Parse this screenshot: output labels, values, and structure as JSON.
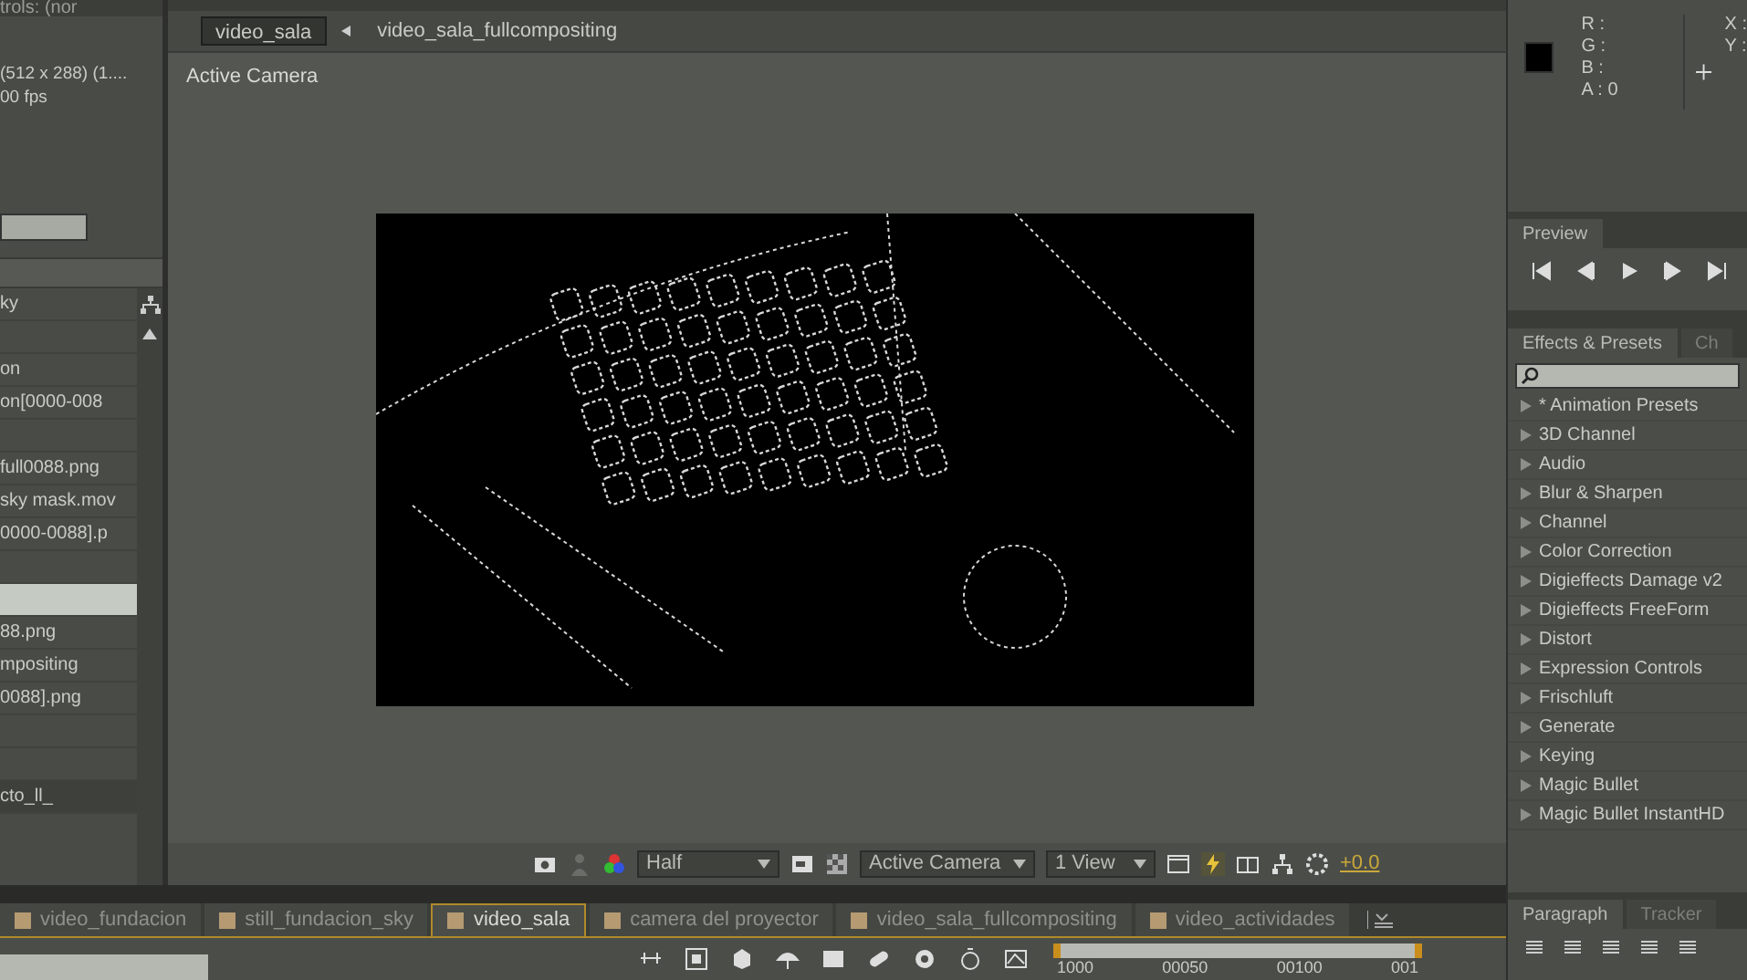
{
  "project_panel": {
    "header": "trols: (nor",
    "info_lines": [
      "(512 x 288) (1....",
      "00 fps"
    ],
    "items": [
      {
        "kind": "text",
        "label": "ky",
        "selected": false
      },
      {
        "kind": "blank",
        "selected": false
      },
      {
        "kind": "text",
        "label": "on",
        "selected": false
      },
      {
        "kind": "text",
        "label": "on[0000-008",
        "selected": false
      },
      {
        "kind": "blank",
        "selected": false
      },
      {
        "kind": "text",
        "label": "full0088.png",
        "selected": false
      },
      {
        "kind": "text",
        "label": "sky mask.mov",
        "selected": false
      },
      {
        "kind": "text",
        "label": "0000-0088].p",
        "selected": false
      },
      {
        "kind": "blank",
        "selected": false
      },
      {
        "kind": "blank",
        "selected": true
      },
      {
        "kind": "text",
        "label": "88.png",
        "selected": false
      },
      {
        "kind": "text",
        "label": "mpositing",
        "selected": false
      },
      {
        "kind": "text",
        "label": "0088].png",
        "selected": false
      },
      {
        "kind": "blank",
        "selected": false
      },
      {
        "kind": "blank",
        "selected": false
      },
      {
        "kind": "text",
        "label": "cto_ll_",
        "selected": false
      }
    ]
  },
  "composition": {
    "breadcrumbs": [
      {
        "label": "video_sala",
        "selected": true
      },
      {
        "label": "video_sala_fullcompositing",
        "selected": false
      }
    ],
    "view_label": "Active Camera",
    "toolbar": {
      "resolution": "Half",
      "camera": "Active Camera",
      "views": "1 View",
      "exposure": "+0.0"
    }
  },
  "timeline": {
    "tabs": [
      {
        "label": "video_fundacion",
        "selected": false
      },
      {
        "label": "still_fundacion_sky",
        "selected": false
      },
      {
        "label": "video_sala",
        "selected": true
      },
      {
        "label": "camera del proyector",
        "selected": false
      },
      {
        "label": "video_sala_fullcompositing",
        "selected": false
      },
      {
        "label": "video_actividades",
        "selected": false
      }
    ],
    "ruler": [
      "1000",
      "00050",
      "00100",
      "001"
    ]
  },
  "info_panel": {
    "channels": [
      "R :",
      "G :",
      "B :",
      "A : 0"
    ],
    "coords": [
      "X :",
      "Y :"
    ]
  },
  "preview_panel": {
    "tab": "Preview"
  },
  "effects_panel": {
    "tabs": [
      {
        "label": "Effects & Presets",
        "selected": true
      },
      {
        "label": "Ch",
        "selected": false
      }
    ],
    "items": [
      "* Animation Presets",
      "3D Channel",
      "Audio",
      "Blur & Sharpen",
      "Channel",
      "Color Correction",
      "Digieffects Damage v2",
      "Digieffects FreeForm",
      "Distort",
      "Expression Controls",
      "Frischluft",
      "Generate",
      "Keying",
      "Magic Bullet",
      "Magic Bullet InstantHD"
    ]
  },
  "paragraph_panel": {
    "tabs": [
      {
        "label": "Paragraph",
        "selected": true
      },
      {
        "label": "Tracker",
        "selected": false
      }
    ]
  }
}
